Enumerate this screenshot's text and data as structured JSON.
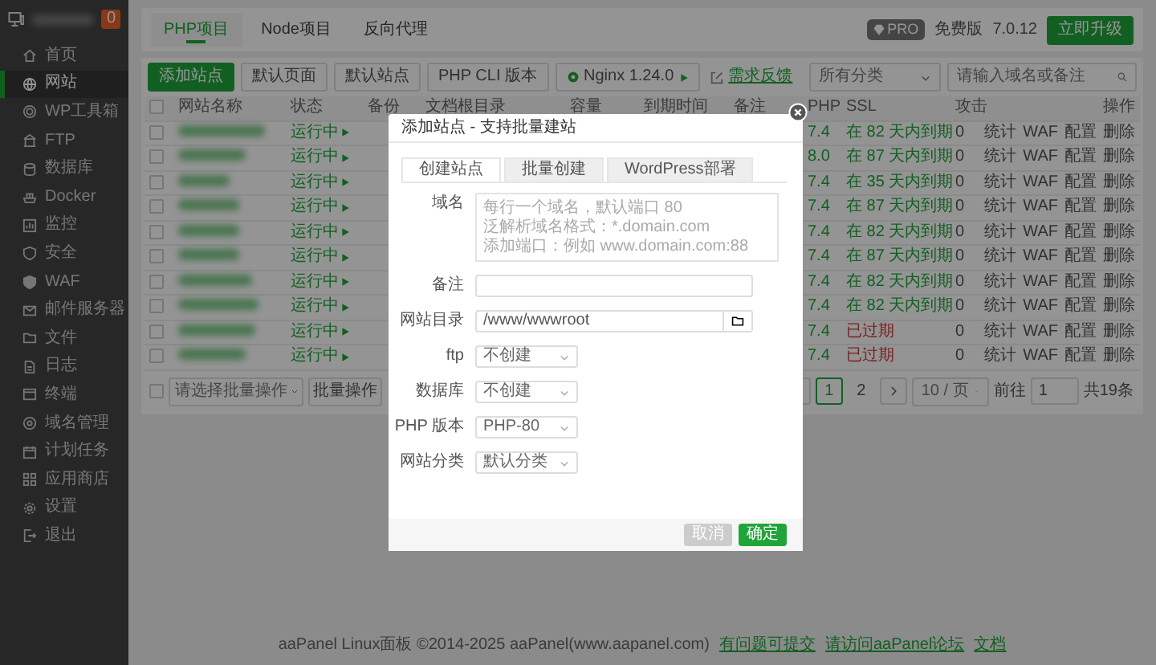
{
  "sidebar": {
    "badge": "0",
    "items": [
      {
        "label": "首页",
        "selected": false
      },
      {
        "label": "网站",
        "selected": true
      },
      {
        "label": "WP工具箱",
        "selected": false
      },
      {
        "label": "FTP",
        "selected": false
      },
      {
        "label": "数据库",
        "selected": false
      },
      {
        "label": "Docker",
        "selected": false
      },
      {
        "label": "监控",
        "selected": false
      },
      {
        "label": "安全",
        "selected": false
      },
      {
        "label": "WAF",
        "selected": false
      },
      {
        "label": "邮件服务器",
        "selected": false
      },
      {
        "label": "文件",
        "selected": false
      },
      {
        "label": "日志",
        "selected": false
      },
      {
        "label": "终端",
        "selected": false
      },
      {
        "label": "域名管理",
        "selected": false
      },
      {
        "label": "计划任务",
        "selected": false
      },
      {
        "label": "应用商店",
        "selected": false
      },
      {
        "label": "设置",
        "selected": false
      },
      {
        "label": "退出",
        "selected": false
      }
    ]
  },
  "top_tabs": [
    {
      "label": "PHP项目",
      "selected": true
    },
    {
      "label": "Node项目",
      "selected": false
    },
    {
      "label": "反向代理",
      "selected": false
    }
  ],
  "edition": {
    "badge": "PRO",
    "label": "免费版",
    "version": "7.0.12",
    "upgrade": "立即升级"
  },
  "toolbar": {
    "buttons": [
      {
        "label": "添加站点",
        "kind": "primary"
      },
      {
        "label": "默认页面",
        "kind": "plain"
      },
      {
        "label": "默认站点",
        "kind": "plain"
      },
      {
        "label": "PHP CLI 版本",
        "kind": "plain"
      }
    ],
    "nginx": "Nginx 1.24.0",
    "feedback": "需求反馈",
    "category": "所有分类",
    "search_placeholder": "请输入域名或备注"
  },
  "table": {
    "header_checked": false,
    "columns": [
      "网站名称",
      "状态",
      "备份",
      "文档根目录",
      "容量",
      "到期时间",
      "备注",
      "PHP",
      "SSL",
      "攻击",
      "操作"
    ],
    "rows": [
      {
        "checked": false,
        "status": "运行中",
        "php": "7.4",
        "ssl": "在 82 天内到期",
        "ssl_expired": false,
        "attacks": "0",
        "actions": [
          "统计",
          "WAF",
          "配置",
          "删除"
        ]
      },
      {
        "checked": false,
        "status": "运行中",
        "php": "8.0",
        "ssl": "在 87 天内到期",
        "ssl_expired": false,
        "attacks": "0",
        "actions": [
          "统计",
          "WAF",
          "配置",
          "删除"
        ]
      },
      {
        "checked": false,
        "status": "运行中",
        "php": "7.4",
        "ssl": "在 35 天内到期",
        "ssl_expired": false,
        "attacks": "0",
        "actions": [
          "统计",
          "WAF",
          "配置",
          "删除"
        ]
      },
      {
        "checked": false,
        "status": "运行中",
        "php": "7.4",
        "ssl": "在 87 天内到期",
        "ssl_expired": false,
        "attacks": "0",
        "actions": [
          "统计",
          "WAF",
          "配置",
          "删除"
        ]
      },
      {
        "checked": false,
        "status": "运行中",
        "php": "7.4",
        "ssl": "在 82 天内到期",
        "ssl_expired": false,
        "attacks": "0",
        "actions": [
          "统计",
          "WAF",
          "配置",
          "删除"
        ]
      },
      {
        "checked": false,
        "status": "运行中",
        "php": "7.4",
        "ssl": "在 87 天内到期",
        "ssl_expired": false,
        "attacks": "0",
        "actions": [
          "统计",
          "WAF",
          "配置",
          "删除"
        ]
      },
      {
        "checked": false,
        "status": "运行中",
        "php": "7.4",
        "ssl": "在 82 天内到期",
        "ssl_expired": false,
        "attacks": "0",
        "actions": [
          "统计",
          "WAF",
          "配置",
          "删除"
        ]
      },
      {
        "checked": false,
        "status": "运行中",
        "php": "7.4",
        "ssl": "在 82 天内到期",
        "ssl_expired": false,
        "attacks": "0",
        "actions": [
          "统计",
          "WAF",
          "配置",
          "删除"
        ]
      },
      {
        "checked": false,
        "status": "运行中",
        "php": "7.4",
        "ssl": "已过期",
        "ssl_expired": true,
        "attacks": "0",
        "actions": [
          "统计",
          "WAF",
          "配置",
          "删除"
        ]
      },
      {
        "checked": false,
        "status": "运行中",
        "php": "7.4",
        "ssl": "已过期",
        "ssl_expired": true,
        "attacks": "0",
        "actions": [
          "统计",
          "WAF",
          "配置",
          "删除"
        ]
      }
    ]
  },
  "batch": {
    "checked": false,
    "placeholder": "请选择批量操作",
    "button": "批量操作"
  },
  "pagination": {
    "pages": [
      {
        "label": "1",
        "selected": true
      },
      {
        "label": "2",
        "selected": false
      }
    ],
    "page_size": "10 / 页",
    "goto_label": "前往",
    "goto_value": "1",
    "total": "共19条"
  },
  "footer": {
    "copyright": "aaPanel Linux面板 ©2014-2025 aaPanel(www.aapanel.com)",
    "links": [
      "有问题可提交",
      "请访问aaPanel论坛",
      "文档"
    ]
  },
  "modal": {
    "title": "添加站点 - 支持批量建站",
    "tabs": [
      {
        "label": "创建站点",
        "selected": true
      },
      {
        "label": "批量创建",
        "selected": false
      },
      {
        "label": "WordPress部署",
        "selected": false
      }
    ],
    "fields": [
      {
        "kind": "textarea",
        "label": "域名",
        "placeholder": "每行一个域名，默认端口 80\n泛解析域名格式：*.domain.com\n添加端口：例如 www.domain.com:88"
      },
      {
        "kind": "input",
        "label": "备注"
      },
      {
        "kind": "path",
        "label": "网站目录",
        "value": "/www/wwwroot"
      },
      {
        "kind": "select",
        "label": "ftp",
        "value": "不创建"
      },
      {
        "kind": "select",
        "label": "数据库",
        "value": "不创建"
      },
      {
        "kind": "select",
        "label": "PHP 版本",
        "value": "PHP-80"
      },
      {
        "kind": "select",
        "label": "网站分类",
        "value": "默认分类"
      }
    ],
    "cancel": "取消",
    "confirm": "确定"
  }
}
